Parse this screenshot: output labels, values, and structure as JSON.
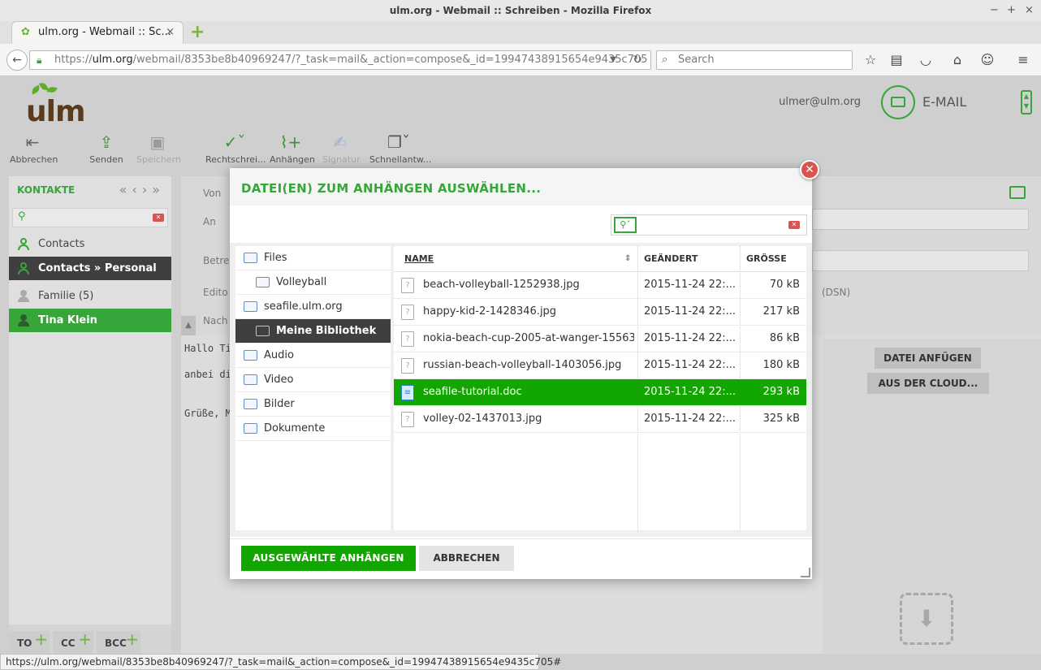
{
  "window": {
    "title": "ulm.org - Webmail :: Schreiben - Mozilla Firefox",
    "minimize": "−",
    "maximize": "+",
    "close": "×"
  },
  "tab": {
    "label": "ulm.org - Webmail :: Sc...",
    "close": "×"
  },
  "nav": {
    "url_prefix": "https://",
    "url_domain": "ulm.org",
    "url_rest": "/webmail/8353be8b40969247/?_task=mail&_action=compose&_id=19947438915654e9435c705",
    "search_placeholder": "Search"
  },
  "app": {
    "logo_text": "ulm",
    "user_email": "ulmer@ulm.org",
    "section_label": "E-MAIL"
  },
  "toolbar": {
    "cancel": "Abbrechen",
    "send": "Senden",
    "save": "Speichern",
    "spell": "Rechtschrei...",
    "attach": "Anhängen",
    "signature": "Signatur",
    "responses": "Schnellantw..."
  },
  "contacts": {
    "title": "KONTAKTE",
    "items": [
      {
        "label": "Contacts"
      },
      {
        "label": "Contacts » Personal ..."
      },
      {
        "label": "Familie (5)"
      },
      {
        "label": "Tina Klein"
      }
    ],
    "recipients": {
      "to": "TO",
      "cc": "CC",
      "bcc": "BCC"
    }
  },
  "compose": {
    "labels": {
      "from": "Von",
      "to": "An",
      "subject": "Betre",
      "editor": "Edito",
      "message": "Nach"
    },
    "dsn": "(DSN)",
    "body_lines": [
      "Hallo Ti",
      "",
      "anbei di",
      "",
      "",
      "Grüße, M"
    ],
    "attach_file": "DATEI ANFÜGEN",
    "from_cloud": "AUS DER CLOUD..."
  },
  "dialog": {
    "title": "DATEI(EN) ZUM ANHÄNGEN AUSWÄHLEN...",
    "search_value": "",
    "folders": [
      {
        "label": "Files",
        "level": 0,
        "selected": false
      },
      {
        "label": "Volleyball",
        "level": 1,
        "selected": false
      },
      {
        "label": "seafile.ulm.org",
        "level": 0,
        "selected": false
      },
      {
        "label": "Meine Bibliothek",
        "level": 1,
        "selected": true
      },
      {
        "label": "Audio",
        "level": 0,
        "selected": false
      },
      {
        "label": "Video",
        "level": 0,
        "selected": false
      },
      {
        "label": "Bilder",
        "level": 0,
        "selected": false
      },
      {
        "label": "Dokumente",
        "level": 0,
        "selected": false
      }
    ],
    "columns": {
      "name": "NAME",
      "changed": "GEÄNDERT",
      "size": "GRÖSSE"
    },
    "files": [
      {
        "name": "beach-volleyball-1252938.jpg",
        "changed": "2015-11-24 22:...",
        "size": "70 kB",
        "selected": false
      },
      {
        "name": "happy-kid-2-1428346.jpg",
        "changed": "2015-11-24 22:...",
        "size": "217 kB",
        "selected": false
      },
      {
        "name": "nokia-beach-cup-2005-at-wanger-15563...",
        "changed": "2015-11-24 22:...",
        "size": "86 kB",
        "selected": false
      },
      {
        "name": "russian-beach-volleyball-1403056.jpg",
        "changed": "2015-11-24 22:...",
        "size": "180 kB",
        "selected": false
      },
      {
        "name": "seafile-tutorial.doc",
        "changed": "2015-11-24 22:...",
        "size": "293 kB",
        "selected": true
      },
      {
        "name": "volley-02-1437013.jpg",
        "changed": "2015-11-24 22:...",
        "size": "325 kB",
        "selected": false
      }
    ],
    "attach_selected": "AUSGEWÄHLTE ANHÄNGEN",
    "cancel": "ABBRECHEN"
  },
  "statusbar": {
    "url": "https://ulm.org/webmail/8353be8b40969247/?_task=mail&_action=compose&_id=19947438915654e9435c705#"
  },
  "colors": {
    "accent": "#37a53a",
    "selected_row": "#11a600",
    "danger": "#d9534f",
    "dark": "#3f3f3f"
  }
}
